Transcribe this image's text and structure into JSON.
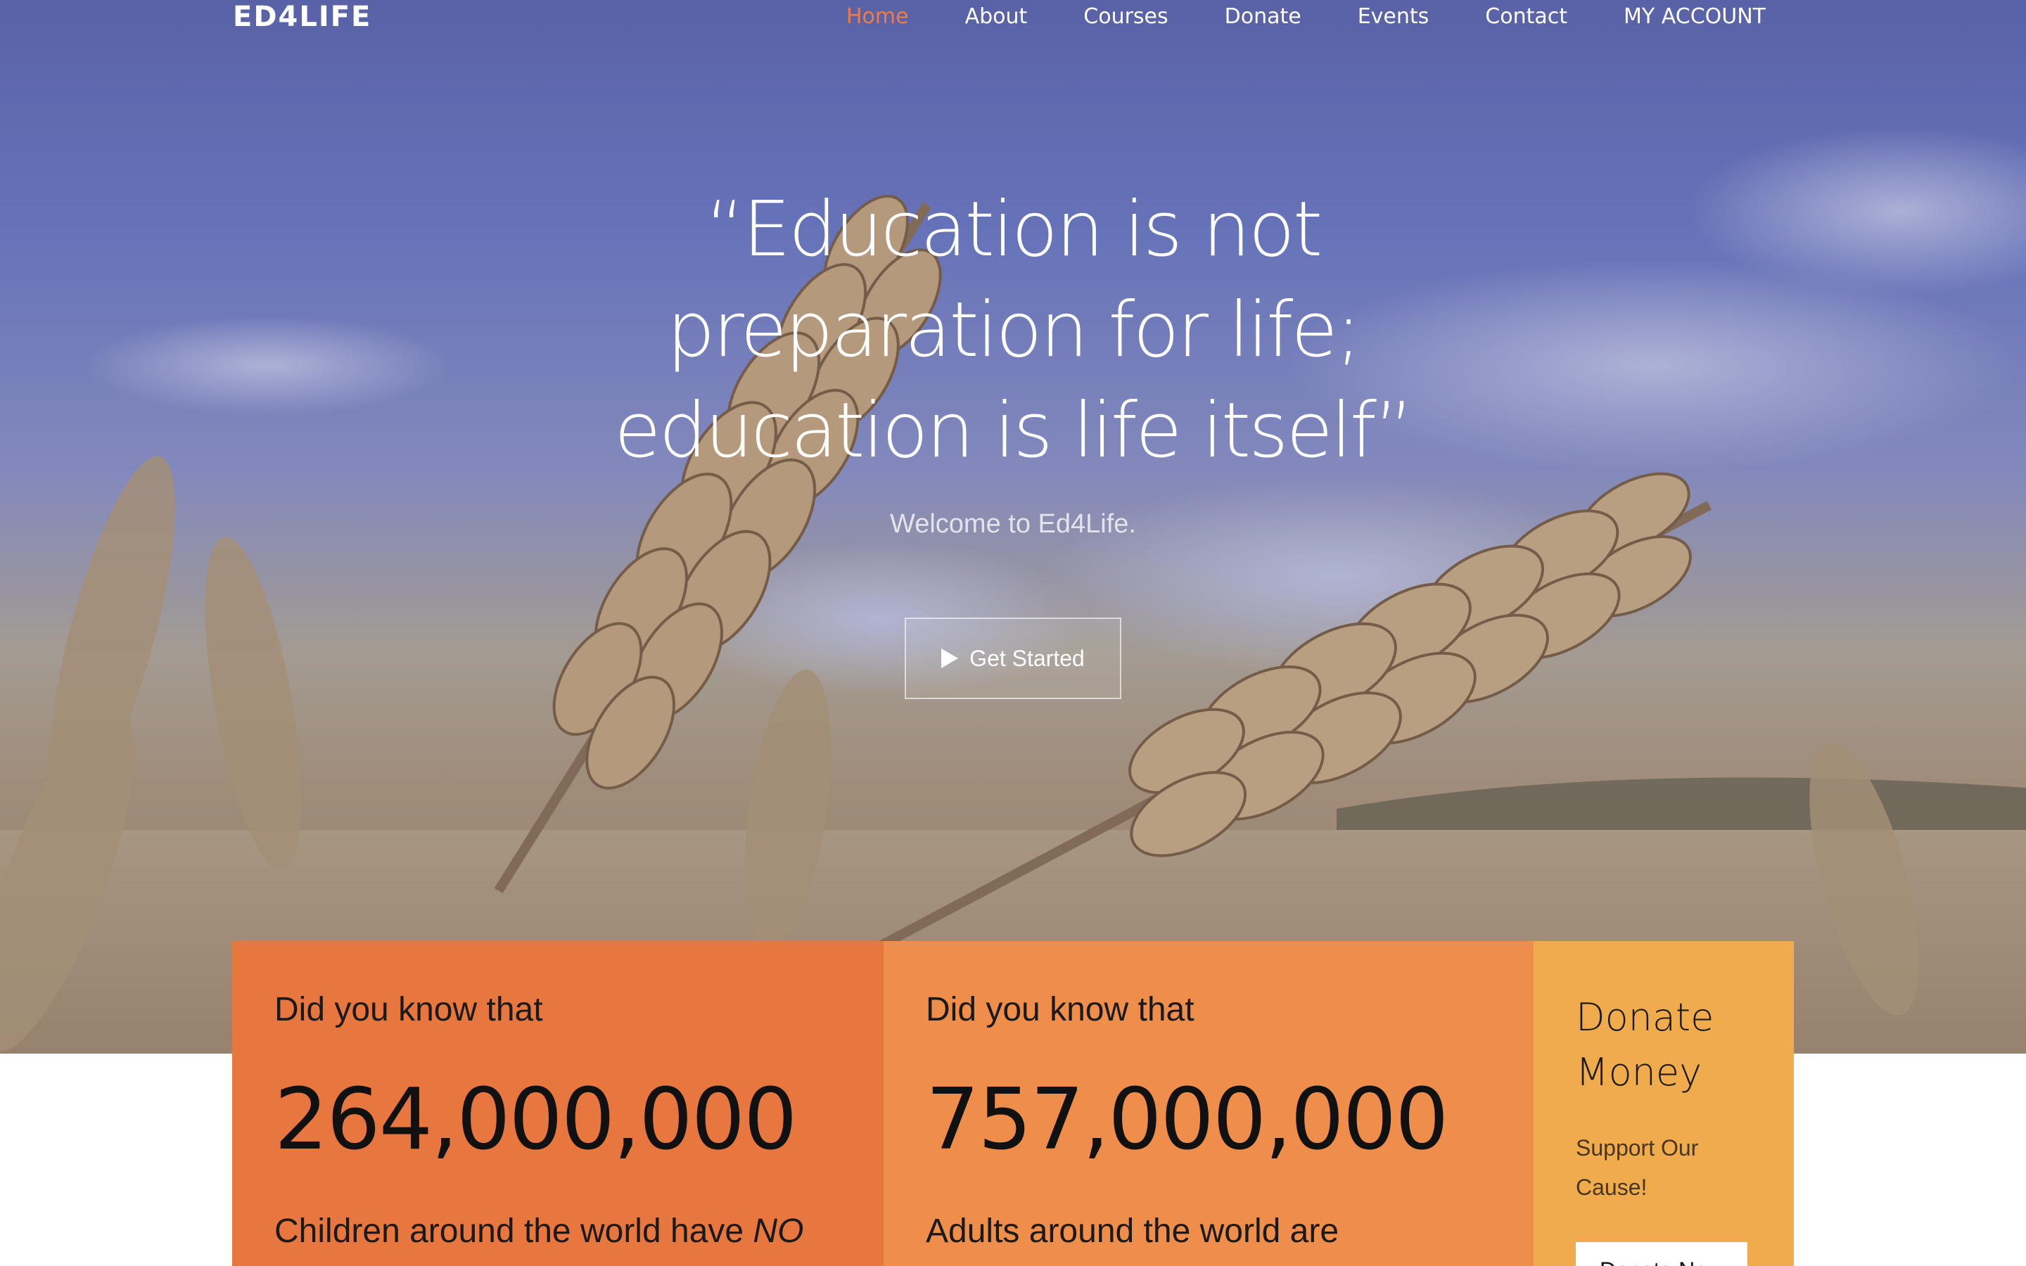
{
  "nav": {
    "brand": "ED4LIFE",
    "links": [
      "Home",
      "About",
      "Courses",
      "Donate",
      "Events",
      "Contact",
      "MY ACCOUNT"
    ],
    "active_color": "#ef7b45"
  },
  "hero": {
    "quote_line_1": "“Education is not",
    "quote_line_2": "preparation for life;",
    "quote_line_3": "education is life itself”",
    "welcome": "Welcome to Ed4Life.",
    "cta_label": "Get Started"
  },
  "stats": [
    {
      "intro": "Did you know that",
      "number": "264,000,000",
      "desc_prefix": "Children around the world have ",
      "desc_emphasis": "NO",
      "color": "#e8763f"
    },
    {
      "intro": "Did you know that",
      "number": "757,000,000",
      "desc_prefix": "Adults around the world are",
      "color": "#ef8e4a"
    }
  ],
  "donate": {
    "title_line_1": "Donate",
    "title_line_2": "Money",
    "subtitle_line_1": "Support Our",
    "subtitle_line_2": "Cause!",
    "button_label": "Donate Now",
    "color": "#f0ac4c"
  }
}
